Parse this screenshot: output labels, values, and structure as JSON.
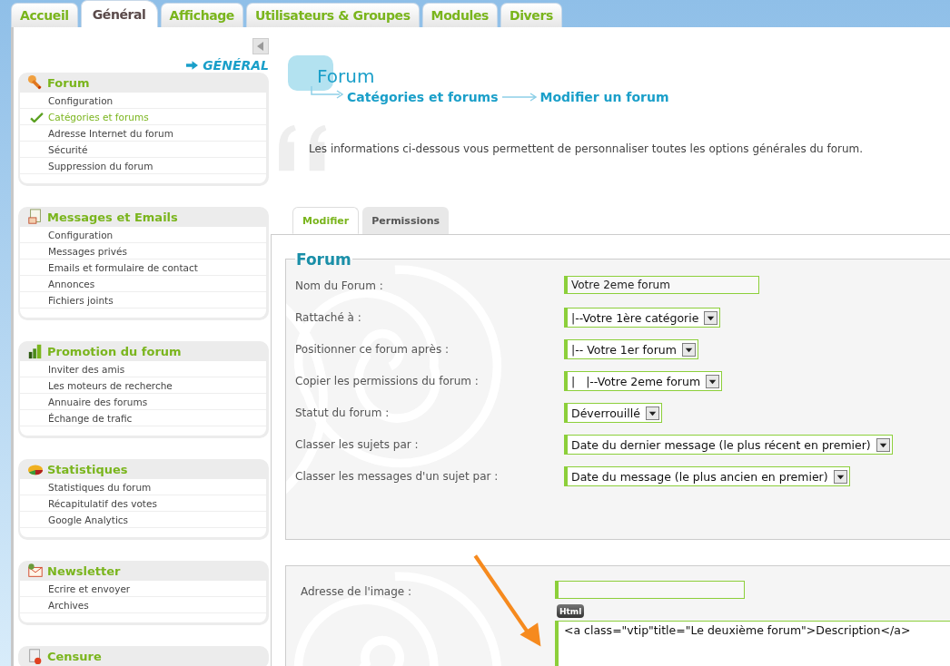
{
  "top_tabs": [
    {
      "label": "Accueil",
      "selected": false
    },
    {
      "label": "Général",
      "selected": true
    },
    {
      "label": "Affichage",
      "selected": false
    },
    {
      "label": "Utilisateurs & Groupes",
      "selected": false
    },
    {
      "label": "Modules",
      "selected": false
    },
    {
      "label": "Divers",
      "selected": false
    }
  ],
  "sidebar": {
    "heading": "GÉNÉRAL",
    "sections": [
      {
        "title": "Forum",
        "items": [
          {
            "label": "Configuration",
            "selected": false
          },
          {
            "label": "Catégories et forums",
            "selected": true
          },
          {
            "label": "Adresse Internet du forum",
            "selected": false
          },
          {
            "label": "Sécurité",
            "selected": false
          },
          {
            "label": "Suppression du forum",
            "selected": false
          }
        ]
      },
      {
        "title": "Messages et Emails",
        "items": [
          {
            "label": "Configuration",
            "selected": false
          },
          {
            "label": "Messages privés",
            "selected": false
          },
          {
            "label": "Emails et formulaire de contact",
            "selected": false
          },
          {
            "label": "Annonces",
            "selected": false
          },
          {
            "label": "Fichiers joints",
            "selected": false
          }
        ]
      },
      {
        "title": "Promotion du forum",
        "items": [
          {
            "label": "Inviter des amis",
            "selected": false
          },
          {
            "label": "Les moteurs de recherche",
            "selected": false
          },
          {
            "label": "Annuaire des forums",
            "selected": false
          },
          {
            "label": "Échange de trafic",
            "selected": false
          }
        ]
      },
      {
        "title": "Statistiques",
        "items": [
          {
            "label": "Statistiques du forum",
            "selected": false
          },
          {
            "label": "Récapitulatif des votes",
            "selected": false
          },
          {
            "label": "Google Analytics",
            "selected": false
          }
        ]
      },
      {
        "title": "Newsletter",
        "items": [
          {
            "label": "Ecrire et envoyer",
            "selected": false
          },
          {
            "label": "Archives",
            "selected": false
          }
        ]
      },
      {
        "title": "Censure"
      }
    ]
  },
  "page": {
    "title": "Forum",
    "breadcrumb": [
      "Catégories et forums",
      "Modifier un forum"
    ],
    "intro": "Les informations ci-dessous vous permettent de personnaliser toutes les options générales du forum.",
    "tabs": [
      {
        "label": "Modifier",
        "selected": true
      },
      {
        "label": "Permissions",
        "selected": false
      }
    ],
    "fieldset": {
      "legend": "Forum",
      "fields": [
        {
          "label": "Nom du Forum :",
          "kind": "text",
          "value": "Votre 2eme forum"
        },
        {
          "label": "Rattaché à :",
          "kind": "select",
          "value": "|--Votre 1ère catégorie"
        },
        {
          "label": "Positionner ce forum après :",
          "kind": "select",
          "value": "|-- Votre 1er forum"
        },
        {
          "label": "Copier les permissions du forum :",
          "kind": "select",
          "value": "|   |--Votre 2eme forum"
        },
        {
          "label": "Statut du forum :",
          "kind": "select",
          "value": "Déverrouillé"
        },
        {
          "label": "Classer les sujets par :",
          "kind": "select",
          "value": "Date du dernier message (le plus récent en premier)"
        },
        {
          "label": "Classer les messages d'un sujet par :",
          "kind": "select",
          "value": "Date du message (le plus ancien en premier)"
        }
      ]
    },
    "image_label": "Adresse de l'image :",
    "html_button": "Html",
    "description": "<a class=\"vtip\"title=\"Le deuxième forum\">Description</a>"
  }
}
